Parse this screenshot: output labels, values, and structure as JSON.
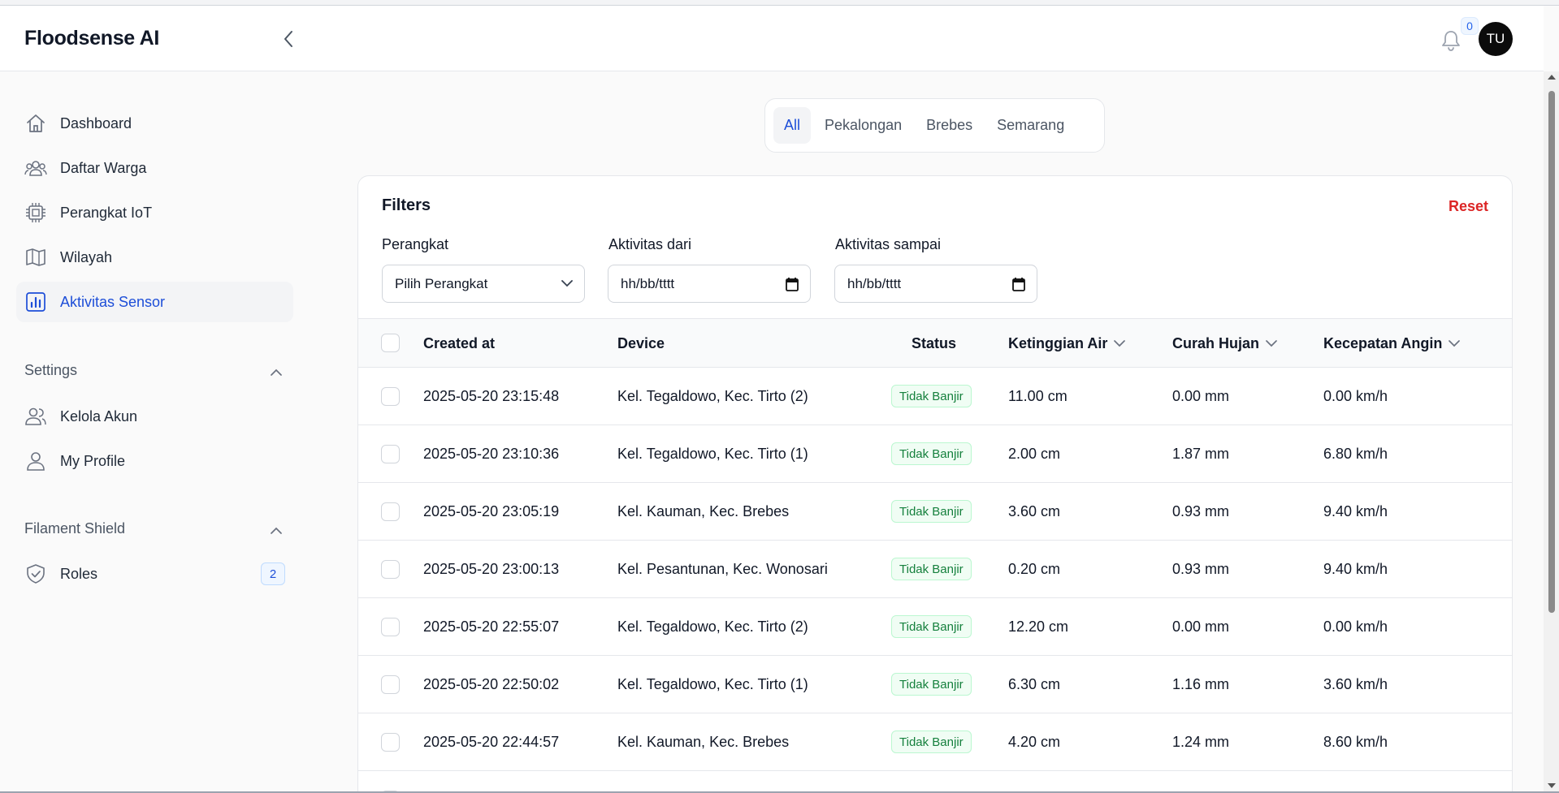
{
  "app": {
    "brand": "Floodsense AI"
  },
  "header": {
    "notification_count": "0",
    "avatar_initials": "TU"
  },
  "sidebar": {
    "items": [
      {
        "label": "Dashboard",
        "icon": "home-icon"
      },
      {
        "label": "Daftar Warga",
        "icon": "users-icon"
      },
      {
        "label": "Perangkat IoT",
        "icon": "chip-icon"
      },
      {
        "label": "Wilayah",
        "icon": "map-icon"
      },
      {
        "label": "Aktivitas Sensor",
        "icon": "chart-bar-icon",
        "active": true
      }
    ],
    "settings": {
      "title": "Settings",
      "items": [
        {
          "label": "Kelola Akun",
          "icon": "users-outline-icon"
        },
        {
          "label": "My Profile",
          "icon": "user-icon"
        }
      ]
    },
    "shield": {
      "title": "Filament Shield",
      "items": [
        {
          "label": "Roles",
          "icon": "shield-check-icon",
          "badge": "2"
        }
      ]
    }
  },
  "tabs": [
    {
      "label": "All",
      "active": true
    },
    {
      "label": "Pekalongan"
    },
    {
      "label": "Brebes"
    },
    {
      "label": "Semarang"
    }
  ],
  "filters": {
    "title": "Filters",
    "reset_label": "Reset",
    "perangkat": {
      "label": "Perangkat",
      "value": "Pilih Perangkat"
    },
    "dari": {
      "label": "Aktivitas dari",
      "value": "hh/bb/tttt"
    },
    "sampai": {
      "label": "Aktivitas sampai",
      "value": "hh/bb/tttt"
    }
  },
  "table": {
    "columns": [
      "Created at",
      "Device",
      "Status",
      "Ketinggian Air",
      "Curah Hujan",
      "Kecepatan Angin"
    ],
    "rows": [
      {
        "created_at": "2025-05-20 23:15:48",
        "device": "Kel. Tegaldowo, Kec. Tirto (2)",
        "status": "Tidak Banjir",
        "air": "11.00 cm",
        "hujan": "0.00 mm",
        "angin": "0.00 km/h"
      },
      {
        "created_at": "2025-05-20 23:10:36",
        "device": "Kel. Tegaldowo, Kec. Tirto (1)",
        "status": "Tidak Banjir",
        "air": "2.00 cm",
        "hujan": "1.87 mm",
        "angin": "6.80 km/h"
      },
      {
        "created_at": "2025-05-20 23:05:19",
        "device": "Kel. Kauman, Kec. Brebes",
        "status": "Tidak Banjir",
        "air": "3.60 cm",
        "hujan": "0.93 mm",
        "angin": "9.40 km/h"
      },
      {
        "created_at": "2025-05-20 23:00:13",
        "device": "Kel. Pesantunan, Kec. Wonosari",
        "status": "Tidak Banjir",
        "air": "0.20 cm",
        "hujan": "0.93 mm",
        "angin": "9.40 km/h"
      },
      {
        "created_at": "2025-05-20 22:55:07",
        "device": "Kel. Tegaldowo, Kec. Tirto (2)",
        "status": "Tidak Banjir",
        "air": "12.20 cm",
        "hujan": "0.00 mm",
        "angin": "0.00 km/h"
      },
      {
        "created_at": "2025-05-20 22:50:02",
        "device": "Kel. Tegaldowo, Kec. Tirto (1)",
        "status": "Tidak Banjir",
        "air": "6.30 cm",
        "hujan": "1.16 mm",
        "angin": "3.60 km/h"
      },
      {
        "created_at": "2025-05-20 22:44:57",
        "device": "Kel. Kauman, Kec. Brebes",
        "status": "Tidak Banjir",
        "air": "4.20 cm",
        "hujan": "1.24 mm",
        "angin": "8.60 km/h"
      }
    ]
  },
  "colors": {
    "accent": "#1d4ed8",
    "danger": "#dc2626",
    "success": "#15803d"
  }
}
